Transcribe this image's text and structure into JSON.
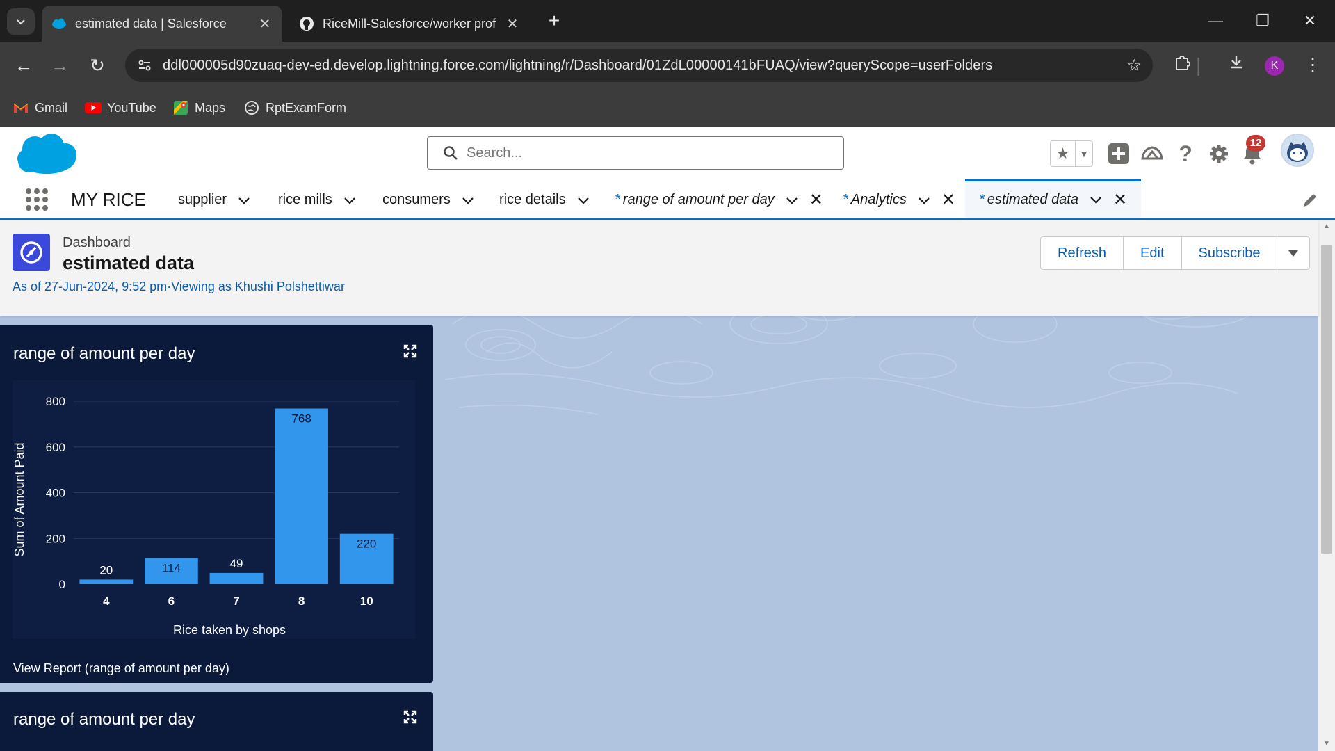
{
  "browser": {
    "tabs": [
      {
        "title": "estimated data | Salesforce",
        "active": true,
        "icon": "salesforce-favicon"
      },
      {
        "title": "RiceMill-Salesforce/worker prof",
        "active": false,
        "icon": "github-favicon"
      }
    ],
    "url": "ddl000005d90zuaq-dev-ed.develop.lightning.force.com/lightning/r/Dashboard/01ZdL00000141bFUAQ/view?queryScope=userFolders",
    "profile_initial": "K",
    "bookmarks": [
      {
        "label": "Gmail",
        "icon": "gmail-icon"
      },
      {
        "label": "YouTube",
        "icon": "youtube-icon"
      },
      {
        "label": "Maps",
        "icon": "maps-icon"
      },
      {
        "label": "RptExamForm",
        "icon": "globe-icon"
      }
    ]
  },
  "sf_header": {
    "search_placeholder": "Search...",
    "notification_count": "12"
  },
  "sf_nav": {
    "app_name": "MY RICE",
    "items": [
      {
        "label": "supplier"
      },
      {
        "label": "rice mills"
      },
      {
        "label": "consumers"
      },
      {
        "label": "rice details"
      },
      {
        "label": "range of amount per day",
        "prefix": "*"
      },
      {
        "label": "Analytics",
        "prefix": "*"
      },
      {
        "label": "estimated data",
        "prefix": "*"
      }
    ]
  },
  "dashboard": {
    "type_label": "Dashboard",
    "title": "estimated data",
    "as_of": "As of 27-Jun-2024, 9:52 pm·Viewing as Khushi Polshettiwar",
    "buttons": {
      "refresh": "Refresh",
      "edit": "Edit",
      "subscribe": "Subscribe"
    },
    "widgets": [
      {
        "title": "range of amount per day",
        "view_report": "View Report (range of amount per day)"
      },
      {
        "title": "range of amount per day"
      }
    ]
  },
  "chart_data": {
    "type": "bar",
    "categories": [
      "4",
      "6",
      "7",
      "8",
      "10"
    ],
    "values": [
      20,
      114,
      49,
      768,
      220
    ],
    "xlabel": "Rice taken by shops",
    "ylabel": "Sum of Amount Paid",
    "ylim": [
      0,
      800
    ],
    "yticks": [
      0,
      200,
      400,
      600,
      800
    ],
    "bar_color": "#3296ed",
    "grid": true
  },
  "colors": {
    "salesforce_blue": "#00a1e0",
    "link_blue": "#0b5cab",
    "nav_accent": "#0070d2",
    "widget_bg": "#0b1a3a",
    "dashboard_bg": "#b0c4df"
  }
}
